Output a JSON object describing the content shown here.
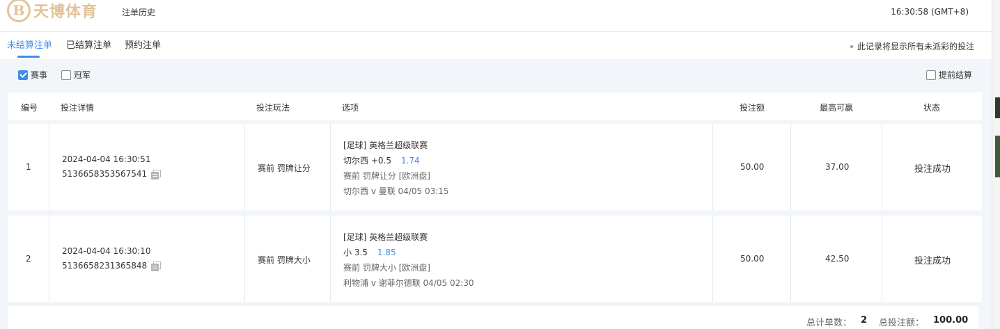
{
  "brand": {
    "logo_mark": "B",
    "logo_text": "天博体育"
  },
  "header": {
    "title": "注单历史",
    "clock": "16:30:58 (GMT+8)"
  },
  "tabs": [
    {
      "label": "未结算注单",
      "active": true
    },
    {
      "label": "已结算注单",
      "active": false
    },
    {
      "label": "预约注单",
      "active": false
    }
  ],
  "notice": "此记录将显示所有未派彩的投注",
  "filters": {
    "event": {
      "label": "赛事",
      "checked": true
    },
    "outright": {
      "label": "冠军",
      "checked": false
    },
    "early_settle": {
      "label": "提前结算",
      "checked": false
    }
  },
  "table": {
    "headers": {
      "no": "编号",
      "detail": "投注详情",
      "play": "投注玩法",
      "selection": "选项",
      "stake": "投注额",
      "max_win": "最高可赢",
      "status": "状态"
    },
    "rows": [
      {
        "no": "1",
        "time": "2024-04-04 16:30:51",
        "bet_id": "5136658353567541",
        "play": "赛前   罚牌让分",
        "league": "[足球] 英格兰超级联赛",
        "pick": "切尔西 +0.5",
        "odds": "1.74",
        "market": "赛前  罚牌让分  [欧洲盘]",
        "match": "切尔西 v 曼联    04/05 03:15",
        "stake": "50.00",
        "max_win": "37.00",
        "status": "投注成功"
      },
      {
        "no": "2",
        "time": "2024-04-04 16:30:10",
        "bet_id": "5136658231365848",
        "play": "赛前   罚牌大小",
        "league": "[足球] 英格兰超级联赛",
        "pick": "小 3.5",
        "odds": "1.85",
        "market": "赛前  罚牌大小  [欧洲盘]",
        "match": "利物浦 v 谢菲尔德联    04/05 02:30",
        "stake": "50.00",
        "max_win": "42.50",
        "status": "投注成功"
      }
    ]
  },
  "footer": {
    "count_label": "总计单数：",
    "count": "2",
    "total_label": "总投注额：",
    "total": "100.00"
  },
  "colors": {
    "accent": "#3d8ee8",
    "brand": "#e2c29a",
    "filter_bg": "#f2f6fa"
  }
}
